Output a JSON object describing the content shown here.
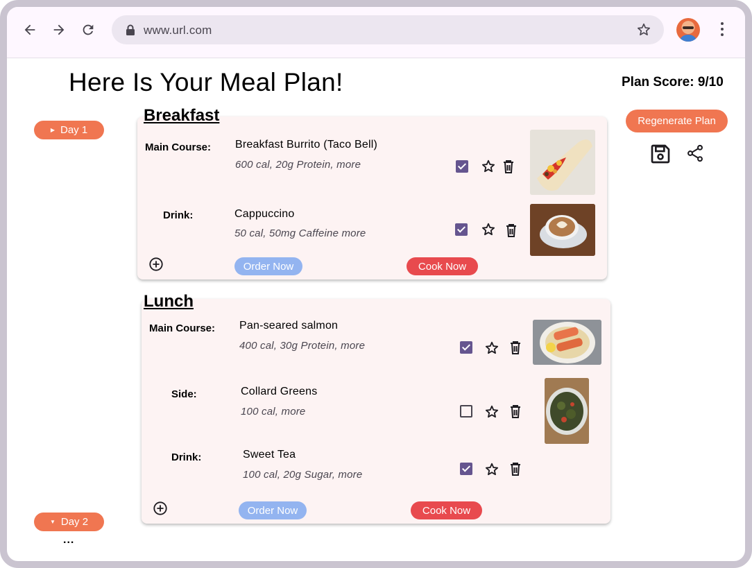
{
  "browser": {
    "url": "www.url.com"
  },
  "page": {
    "title": "Here Is Your Meal Plan!",
    "plan_score": "Plan Score: 9/10"
  },
  "days": [
    {
      "label": "Day 1",
      "state": "collapsed"
    },
    {
      "label": "Day 2",
      "state": "expanded"
    }
  ],
  "more_days": "...",
  "actions": {
    "regenerate_label": "Regenerate Plan"
  },
  "meals": {
    "breakfast": {
      "title": "Breakfast",
      "items": [
        {
          "label": "Main Course:",
          "name": "Breakfast Burrito (Taco Bell)",
          "meta": "600 cal, 20g Protein, more",
          "checked": true,
          "image": "breakfast burrito photo"
        },
        {
          "label": "Drink:",
          "name": "Cappuccino",
          "meta": "50 cal, 50mg Caffeine more",
          "checked": true,
          "image": "cappuccino photo"
        }
      ],
      "order_label": "Order Now",
      "cook_label": "Cook Now"
    },
    "lunch": {
      "title": "Lunch",
      "items": [
        {
          "label": "Main Course:",
          "name": "Pan-seared salmon",
          "meta": "400 cal, 30g Protein, more",
          "checked": true,
          "image": "pan-seared salmon photo"
        },
        {
          "label": "Side:",
          "name": "Collard Greens",
          "meta": "100 cal, more",
          "checked": false,
          "image": "collard greens photo"
        },
        {
          "label": "Drink:",
          "name": "Sweet Tea",
          "meta": "100 cal, 20g Sugar, more",
          "checked": true
        }
      ],
      "order_label": "Order Now",
      "cook_label": "Cook Now"
    }
  },
  "colors": {
    "accent_orange": "#f07651",
    "order_blue": "#93b4f0",
    "cook_red": "#e84a4e",
    "checkbox_purple": "#65558f",
    "card_bg": "#fdf3f3"
  },
  "icons": [
    "back-arrow-icon",
    "forward-arrow-icon",
    "reload-icon",
    "lock-icon",
    "bookmark-star-icon",
    "kebab-menu-icon",
    "save-icon",
    "share-icon",
    "star-icon",
    "trash-icon",
    "add-circle-icon",
    "caret-right-icon",
    "caret-down-icon"
  ]
}
